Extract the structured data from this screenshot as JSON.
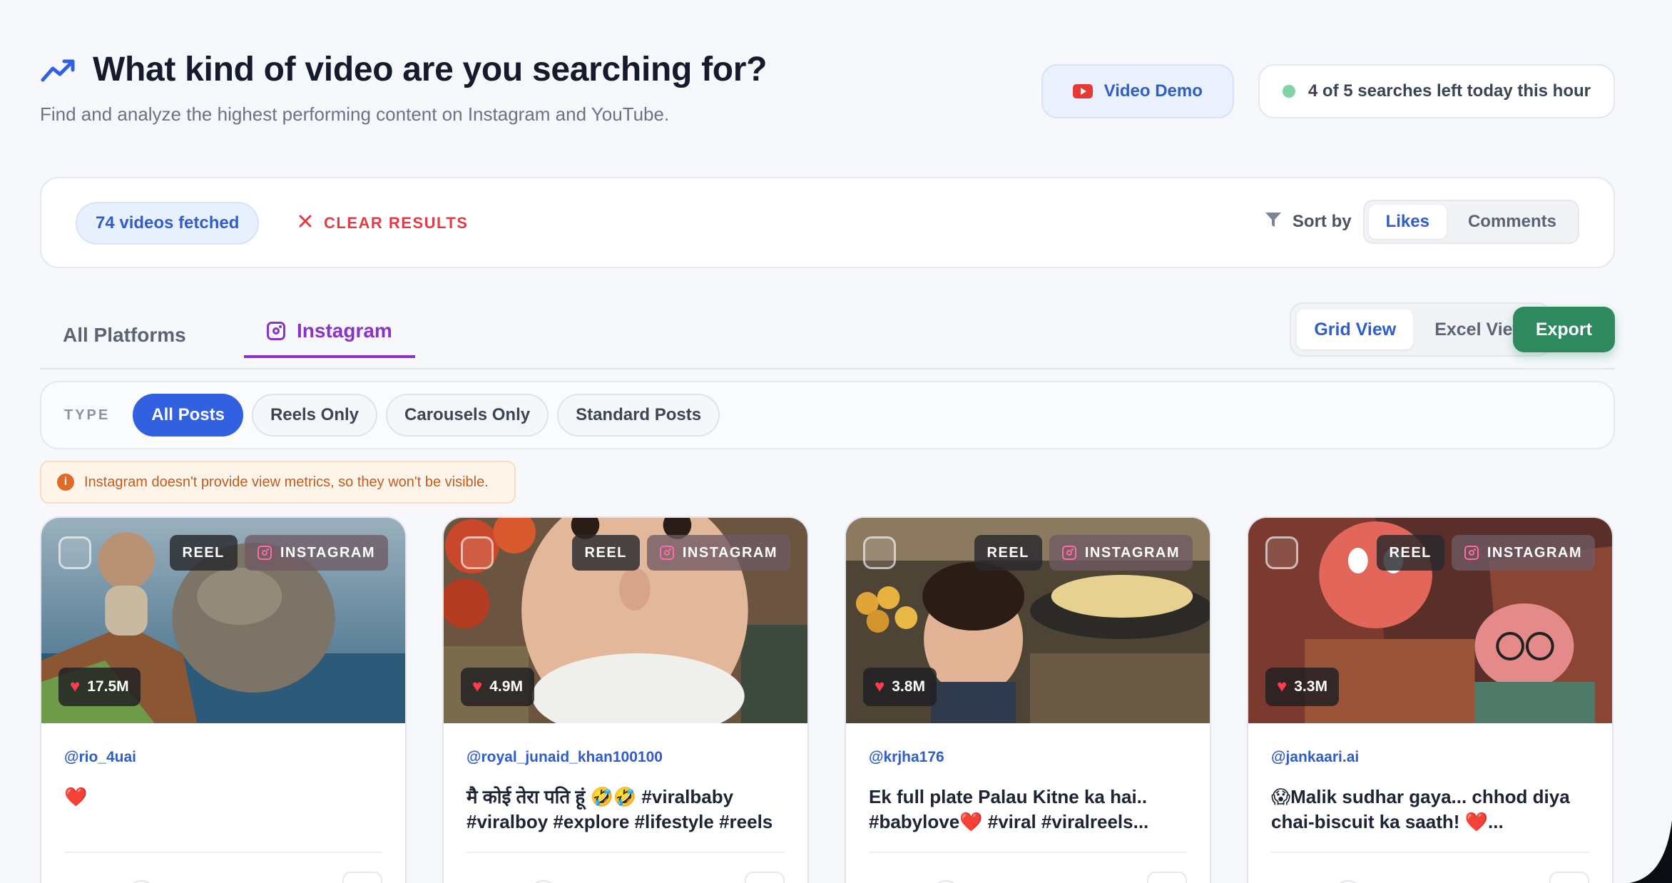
{
  "header": {
    "title": "What kind of video are you searching for?",
    "subtitle": "Find and analyze the highest performing content on Instagram and YouTube.",
    "video_demo_label": "Video Demo",
    "searches_left_label": "4 of 5 searches left today this hour"
  },
  "results": {
    "fetched_label": "74 videos fetched",
    "clear_label": "CLEAR RESULTS",
    "sort_label": "Sort by",
    "sort_options": [
      "Likes",
      "Comments"
    ],
    "sort_selected": "Likes"
  },
  "tabs": {
    "all": "All Platforms",
    "instagram": "Instagram",
    "active": "Instagram"
  },
  "view": {
    "options": [
      "Grid View",
      "Excel View"
    ],
    "selected": "Grid View",
    "export_label": "Export"
  },
  "type_filter": {
    "label": "TYPE",
    "options": [
      "All Posts",
      "Reels Only",
      "Carousels Only",
      "Standard Posts"
    ],
    "selected": "All Posts"
  },
  "notice": {
    "text": "Instagram doesn't provide view metrics, so they won't be visible."
  },
  "cards": [
    {
      "type_badge": "REEL",
      "platform_badge": "INSTAGRAM",
      "likes": "17.5M",
      "handle": "@rio_4uai",
      "caption": "❤️"
    },
    {
      "type_badge": "REEL",
      "platform_badge": "INSTAGRAM",
      "likes": "4.9M",
      "handle": "@royal_junaid_khan100100",
      "caption": "मै कोई तेरा पति हूं 🤣🤣 #viralbaby #viralboy #explore #lifestyle #reels"
    },
    {
      "type_badge": "REEL",
      "platform_badge": "INSTAGRAM",
      "likes": "3.8M",
      "handle": "@krjha176",
      "caption": "Ek full plate Palau Kitne ka hai.. #babylove❤️ #viral #viralreels..."
    },
    {
      "type_badge": "REEL",
      "platform_badge": "INSTAGRAM",
      "likes": "3.3M",
      "handle": "@jankaari.ai",
      "caption": "😱Malik sudhar gaya... chhod diya chai-biscuit ka saath! ❤️..."
    }
  ],
  "colors": {
    "accent_blue": "#3160e0",
    "instagram_purple": "#8a33c9",
    "export_green": "#2e8a5e",
    "clear_red": "#e23c46"
  }
}
